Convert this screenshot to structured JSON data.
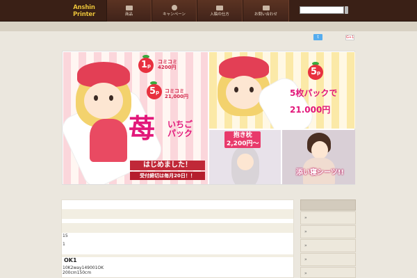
{
  "header": {
    "logo_lines": [
      "Anshin",
      "Printer"
    ],
    "nav": [
      {
        "label": "商品",
        "icon": "tag-icon"
      },
      {
        "label": "キャンペーン",
        "icon": "star-icon"
      },
      {
        "label": "入稿の仕方",
        "icon": "cart-icon"
      },
      {
        "label": "お問い合わせ",
        "icon": "mail-icon"
      }
    ],
    "search": {
      "value": "",
      "placeholder": ""
    }
  },
  "share": {
    "twitter_label": "t",
    "gplus_label": "G+1"
  },
  "banner": {
    "left": {
      "badge1": "1",
      "badge1_unit": "p",
      "price1_line1": "コミコミ",
      "price1_line2": "4200円",
      "badge2": "5",
      "badge2_unit": "p",
      "price2_line1": "コミコミ",
      "price2_line2": "21,000円",
      "kanji": "苺",
      "side_line1": "いちご",
      "side_line2": "パック",
      "bar": "はじめました！",
      "deadline": "受付締切は毎月20日！！"
    },
    "top_right": {
      "badge": "5",
      "badge_unit": "p",
      "promo_line1": "5枚パックで",
      "promo_line2": "21.000円"
    },
    "bottom_right_1": {
      "tag_line1": "抱き枕",
      "tag_line2": "2,200円～"
    },
    "bottom_right_2": {
      "tag": "添い寝シーツ!!"
    }
  },
  "content": {
    "lines": [
      "15",
      "1"
    ],
    "title": "OK1",
    "details": [
      "10K2way149001OK",
      "200cm150cm"
    ]
  },
  "sidebar": {
    "items": [
      "»",
      "»",
      "»",
      "»",
      "»"
    ]
  },
  "colors": {
    "header_bg": "#3a2016",
    "accent_pink": "#e2177a",
    "strawberry_red": "#e8303f",
    "logo_gold": "#f2c53d"
  }
}
